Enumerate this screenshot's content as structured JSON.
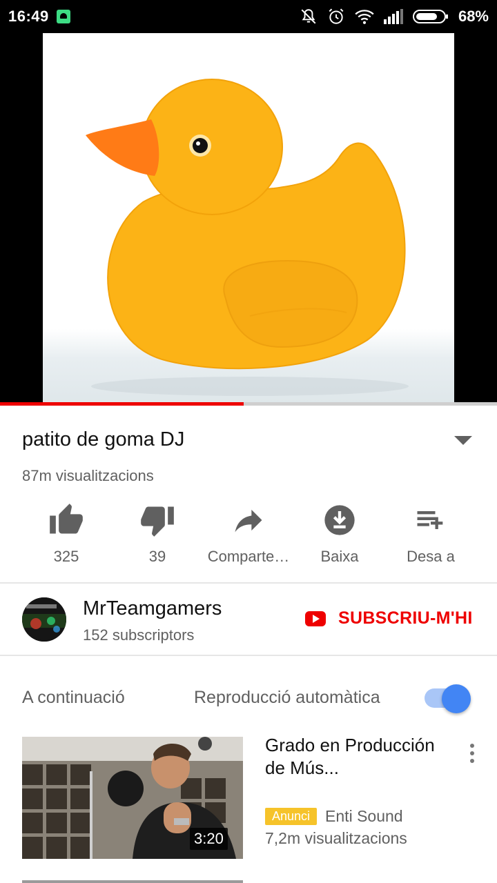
{
  "status_bar": {
    "time": "16:49",
    "battery_percent": "68%",
    "icons": [
      "android-icon",
      "mute-bell-icon",
      "alarm-icon",
      "wifi-icon",
      "signal-icon",
      "battery-icon"
    ]
  },
  "player": {
    "progress_fraction": 0.49,
    "progress_color": "#ee0000"
  },
  "video": {
    "title": "patito de goma DJ",
    "views": "87m visualitzacions"
  },
  "actions": {
    "like": {
      "label": "325",
      "icon": "thumbs-up-icon"
    },
    "dislike": {
      "label": "39",
      "icon": "thumbs-down-icon"
    },
    "share": {
      "label": "Comparte…",
      "icon": "share-icon"
    },
    "download": {
      "label": "Baixa",
      "icon": "download-icon"
    },
    "save": {
      "label": "Desa a",
      "icon": "playlist-add-icon"
    }
  },
  "channel": {
    "name": "MrTeamgamers",
    "subscribers": "152 subscriptors",
    "subscribe_label": "SUBSCRIU-M'HI",
    "brand_color": "#ee0000"
  },
  "up_next": {
    "heading": "A continuació",
    "autoplay_label": "Reproducció automàtica",
    "autoplay_on": true,
    "items": [
      {
        "title": "Grado en Producción de Mús...",
        "badge": "Anunci",
        "channel": "Enti Sound",
        "views": "7,2m visualitzacions",
        "duration": "3:20"
      }
    ]
  }
}
